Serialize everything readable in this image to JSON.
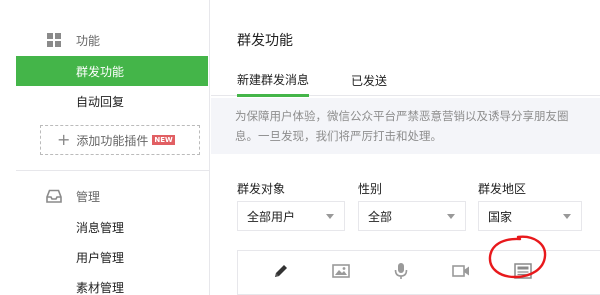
{
  "sidebar": {
    "function_section": {
      "label": "功能",
      "icon": "grid-icon"
    },
    "items": [
      {
        "label": "群发功能",
        "active": true
      },
      {
        "label": "自动回复",
        "active": false
      }
    ],
    "add_plugin": {
      "label": "添加功能插件",
      "badge": "NEW"
    },
    "manage_section": {
      "label": "管理",
      "icon": "inbox-icon"
    },
    "manage_items": [
      {
        "label": "消息管理"
      },
      {
        "label": "用户管理"
      },
      {
        "label": "素材管理"
      }
    ]
  },
  "main": {
    "title": "群发功能",
    "tabs": [
      {
        "label": "新建群发消息",
        "active": true
      },
      {
        "label": "已发送",
        "active": false
      }
    ],
    "notice": {
      "line1": "为保障用户体验，微信公众平台严禁恶意营销以及诱导分享朋友圈",
      "line2": "息。一旦发现，我们将严厉打击和处理。"
    },
    "filters": {
      "target": {
        "label": "群发对象",
        "value": "全部用户"
      },
      "gender": {
        "label": "性别",
        "value": "全部"
      },
      "region": {
        "label": "群发地区",
        "value": "国家"
      }
    },
    "toolbar": [
      "pencil-icon",
      "image-icon",
      "microphone-icon",
      "video-icon",
      "article-icon"
    ]
  },
  "colors": {
    "accent": "#44b549",
    "badge": "#e15f63",
    "annotation": "#e8191c"
  }
}
